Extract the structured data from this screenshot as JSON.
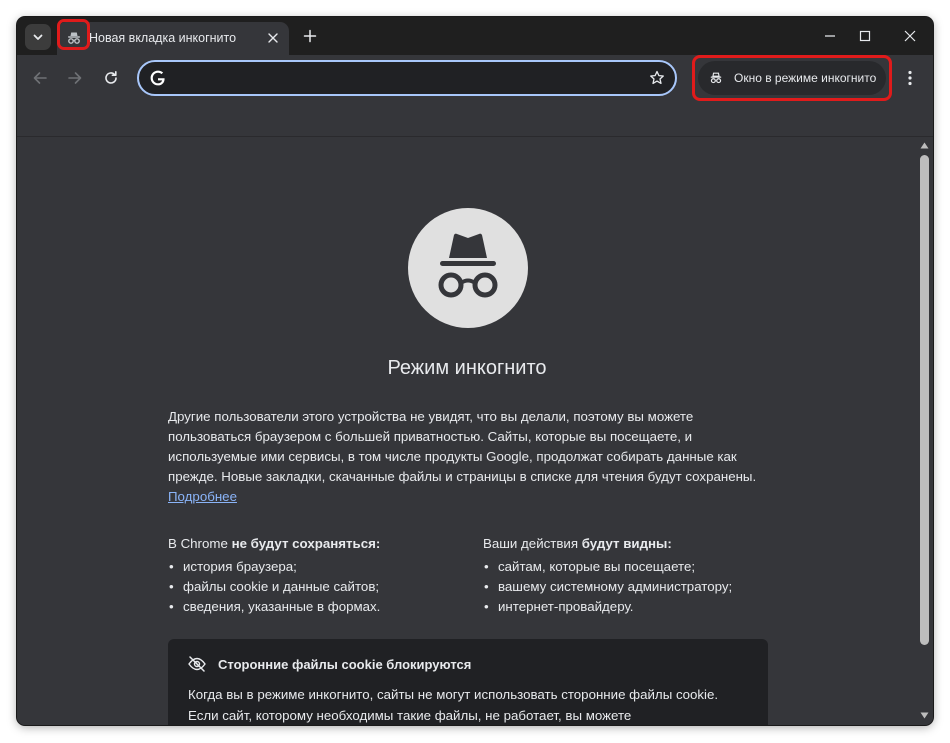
{
  "tab": {
    "title": "Новая вкладка инкогнито",
    "icon": "incognito-icon"
  },
  "toolbar": {
    "omnibox_value": "",
    "incognito_chip_label": "Окно в режиме инкогнито"
  },
  "page": {
    "heading": "Режим инкогнито",
    "intro": "Другие пользователи этого устройства не увидят, что вы делали, поэтому вы можете пользоваться браузером с большей приватностью. Сайты, которые вы посещаете, и используемые ими сервисы, в том числе продукты Google, продолжат собирать данные как прежде. Новые закладки, скачанные файлы и страницы в списке для чтения будут сохранены.",
    "learn_more": "Подробнее",
    "not_saved": {
      "heading_prefix": "В Chrome ",
      "heading_bold": "не будут сохраняться:",
      "items": [
        "история браузера;",
        "файлы cookie и данные сайтов;",
        "сведения, указанные в формах."
      ]
    },
    "visible": {
      "heading_prefix": "Ваши действия ",
      "heading_bold": "будут видны:",
      "items": [
        "сайтам, которые вы посещаете;",
        "вашему системному администратору;",
        "интернет-провайдеру."
      ]
    },
    "cookie_card": {
      "title": "Сторонние файлы cookie блокируются",
      "text": "Когда вы в режиме инкогнито, сайты не могут использовать сторонние файлы cookie. Если сайт, которому необходимы такие файлы, не работает, вы можете"
    }
  },
  "colors": {
    "highlight": "#e01b1b",
    "link": "#8ab4f8",
    "omnibox_border": "#a8c7fa"
  }
}
